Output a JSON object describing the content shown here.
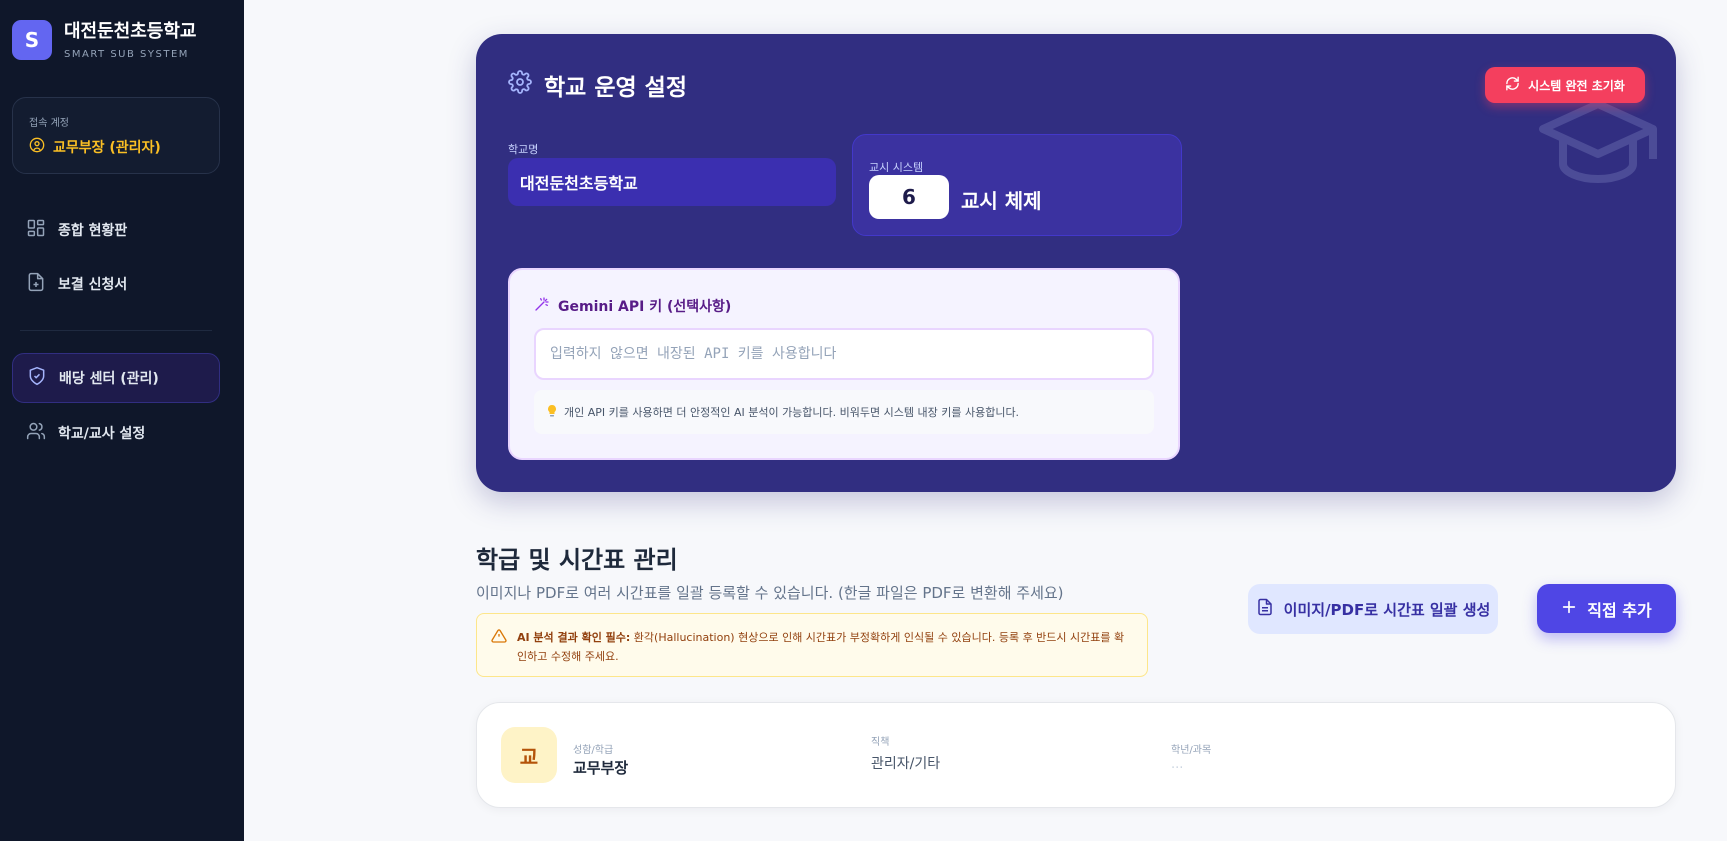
{
  "sidebar": {
    "brand_initial": "S",
    "brand_name": "대전둔천초등학교",
    "brand_sub": "SMART SUB SYSTEM",
    "account_caption": "접속 계정",
    "account_name": "교무부장 (관리자)",
    "nav": [
      {
        "label": "종합 현황판",
        "icon": "dashboard-icon"
      },
      {
        "label": "보결 신청서",
        "icon": "file-plus-icon"
      },
      {
        "label": "배당 센터 (관리)",
        "icon": "shield-check-icon",
        "active": true
      },
      {
        "label": "학교/교사 설정",
        "icon": "users-icon"
      }
    ]
  },
  "settings": {
    "title": "학교 운영 설정",
    "reset_label": "시스템 완전 초기화",
    "school_label": "학교명",
    "school_value": "대전둔천초등학교",
    "period_label": "교시 시스템",
    "period_value": "6",
    "period_unit": "교시 체제",
    "gemini_title": "Gemini API 키 (선택사항)",
    "gemini_placeholder": "입력하지 않으면 내장된 API 키를 사용합니다",
    "gemini_note": "개인 API 키를 사용하면 더 안정적인 AI 분석이 가능합니다. 비워두면 시스템 내장 키를 사용합니다."
  },
  "timetable": {
    "title": "학급 및 시간표 관리",
    "subtitle": "이미지나 PDF로 여러 시간표를 일괄 등록할 수 있습니다. (한글 파일은 PDF로 변환해 주세요)",
    "warning_bold": "AI 분석 결과 확인 필수:",
    "warning_text": " 환각(Hallucination) 현상으로 인해 시간표가 부정확하게 인식될 수 있습니다. 등록 후 반드시 시간표를 확인하고 수정해 주세요.",
    "bulk_label": "이미지/PDF로 시간표 일괄 생성",
    "add_label": "직접 추가"
  },
  "teacher": {
    "avatar": "교",
    "name_caption": "성함/학급",
    "name": "교무부장",
    "role_caption": "직책",
    "role": "관리자/기타",
    "subject_caption": "학년/과목",
    "subject": "..."
  },
  "colors": {
    "sidebar_bg": "#0f172a",
    "accent": "#4f46e5",
    "card_bg": "#312e81",
    "danger": "#f43f5e",
    "account": "#fbbf24"
  }
}
